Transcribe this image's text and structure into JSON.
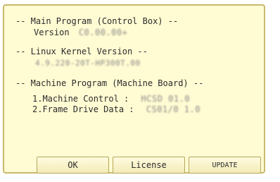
{
  "sections": {
    "main_program": {
      "header": "-- Main Program (Control Box) --",
      "version_label": "Version",
      "version_value": "C0.00.00+"
    },
    "linux_kernel": {
      "header": "-- Linux Kernel Version --",
      "version_value": "4.9.220-20T-HP300T.00"
    },
    "machine_program": {
      "header": "-- Machine Program (Machine Board) --",
      "items": [
        {
          "label": "1.Machine Control  :",
          "value": "HCSD 01.0"
        },
        {
          "label": "2.Frame Drive Data :",
          "value": "CS01/0 1.0"
        }
      ]
    }
  },
  "buttons": {
    "ok": "OK",
    "license": "License",
    "update": "UPDATE"
  },
  "colors": {
    "dialog_background": "#fffbd3",
    "dialog_border": "#c9b96c",
    "button_border": "#b7a85b"
  }
}
